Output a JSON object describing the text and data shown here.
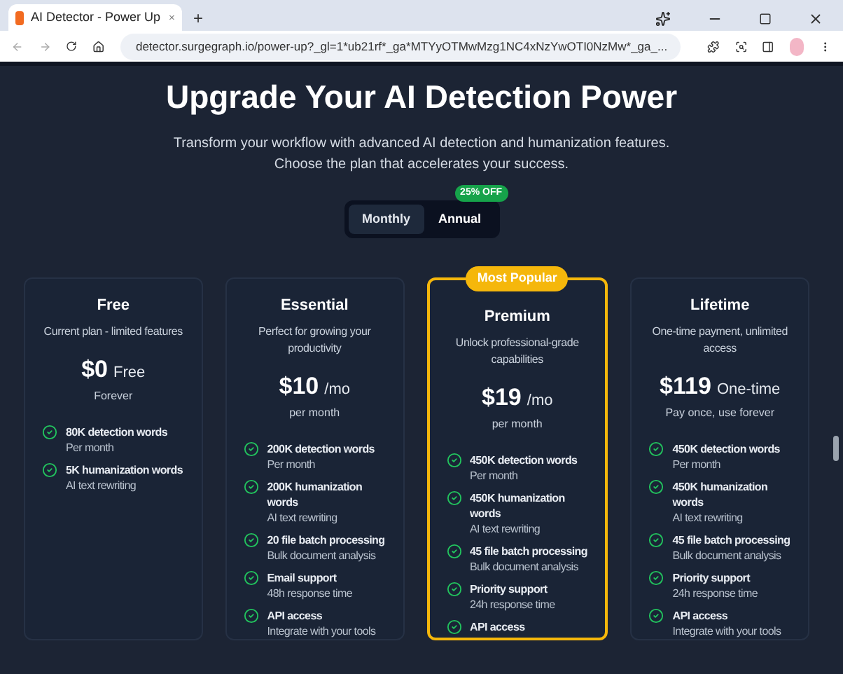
{
  "browser": {
    "tab_title": "AI Detector - Power Up",
    "new_tab": "+",
    "url": "detector.surgegraph.io/power-up?_gl=1*ub21rf*_ga*MTYyOTMwMzg1NC4xNzYwOTI0NzMw*_ga_..."
  },
  "header": {
    "title": "Upgrade Your AI Detection Power",
    "subtitle_lines": [
      "Transform your workflow with advanced AI detection and humanization features.",
      "Choose the plan that accelerates your success."
    ]
  },
  "billing": {
    "options": [
      {
        "label": "Monthly",
        "selected": true
      },
      {
        "label": "Annual",
        "selected": false
      }
    ],
    "badge": "25% OFF"
  },
  "plans": [
    {
      "name": "Free",
      "description": "Current plan - limited features",
      "price": "$0",
      "price_unit": "Free",
      "price_note": "Forever",
      "featured": false,
      "features": [
        {
          "title": "80K detection words",
          "detail": "Per month"
        },
        {
          "title": "5K humanization words",
          "detail": "AI text rewriting"
        }
      ]
    },
    {
      "name": "Essential",
      "description": "Perfect for growing your productivity",
      "price": "$10",
      "price_unit": "/mo",
      "price_note": "per month",
      "featured": false,
      "features": [
        {
          "title": "200K detection words",
          "detail": "Per month"
        },
        {
          "title": "200K humanization words",
          "detail": "AI text rewriting"
        },
        {
          "title": "20 file batch processing",
          "detail": "Bulk document analysis"
        },
        {
          "title": "Email support",
          "detail": "48h response time"
        },
        {
          "title": "API access",
          "detail": "Integrate with your tools"
        }
      ]
    },
    {
      "name": "Premium",
      "badge": "Most Popular",
      "description": "Unlock professional-grade capabilities",
      "price": "$19",
      "price_unit": "/mo",
      "price_note": "per month",
      "featured": true,
      "features": [
        {
          "title": "450K detection words",
          "detail": "Per month"
        },
        {
          "title": "450K humanization words",
          "detail": "AI text rewriting"
        },
        {
          "title": "45 file batch processing",
          "detail": "Bulk document analysis"
        },
        {
          "title": "Priority support",
          "detail": "24h response time"
        },
        {
          "title": "API access"
        }
      ]
    },
    {
      "name": "Lifetime",
      "description": "One-time payment, unlimited access",
      "price": "$119",
      "price_unit": "One-time",
      "price_note": "Pay once, use forever",
      "featured": false,
      "features": [
        {
          "title": "450K detection words",
          "detail": "Per month"
        },
        {
          "title": "450K humanization words",
          "detail": "AI text rewriting"
        },
        {
          "title": "45 file batch processing",
          "detail": "Bulk document analysis"
        },
        {
          "title": "Priority support",
          "detail": "24h response time"
        },
        {
          "title": "API access",
          "detail": "Integrate with your tools"
        }
      ]
    }
  ]
}
